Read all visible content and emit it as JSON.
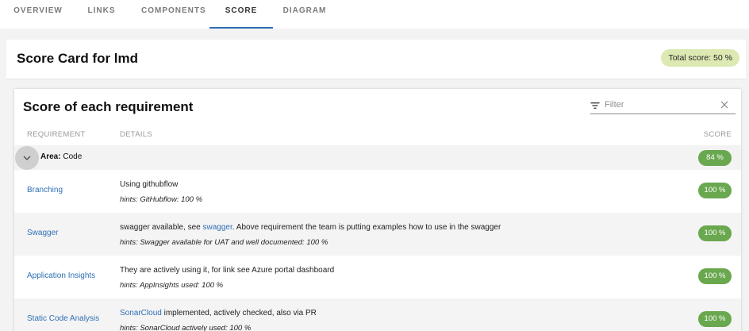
{
  "tabs": [
    "OVERVIEW",
    "LINKS",
    "COMPONENTS",
    "SCORE",
    "DIAGRAM"
  ],
  "active_tab": "SCORE",
  "header": {
    "title": "Score Card for lmd",
    "total_score": "Total score: 50 %",
    "total_score_color": "#dde9b3"
  },
  "panel": {
    "title": "Score of each requirement",
    "filter_placeholder": "Filter",
    "columns": {
      "requirement": "REQUIREMENT",
      "details": "DETAILS",
      "score": "SCORE"
    }
  },
  "area": {
    "label": "Area:",
    "name": "Code",
    "score": "84 %"
  },
  "score_badge_color": "#6aa84f",
  "rows": [
    {
      "name": "Branching",
      "detail_pre": "Using githubflow",
      "detail_link": "",
      "detail_post": "",
      "hint": "hints: GitHubflow: 100 %",
      "score": "100 %"
    },
    {
      "name": "Swagger",
      "detail_pre": "swagger available, see ",
      "detail_link": "swagger",
      "detail_post": ". Above requirement the team is putting examples how to use in the swagger",
      "hint": "hints: Swagger available for UAT and well documented: 100 %",
      "score": "100 %"
    },
    {
      "name": "Application Insights",
      "detail_pre": "They are actively using it, for link see Azure portal dashboard",
      "detail_link": "",
      "detail_post": "",
      "hint": "hints: AppInsights used: 100 %",
      "score": "100 %"
    },
    {
      "name": "Static Code Analysis",
      "detail_pre": "",
      "detail_link": "SonarCloud",
      "detail_post": " implemented, actively checked, also via PR",
      "hint": "hints: SonarCloud actively used: 100 %",
      "score": "100 %"
    }
  ]
}
